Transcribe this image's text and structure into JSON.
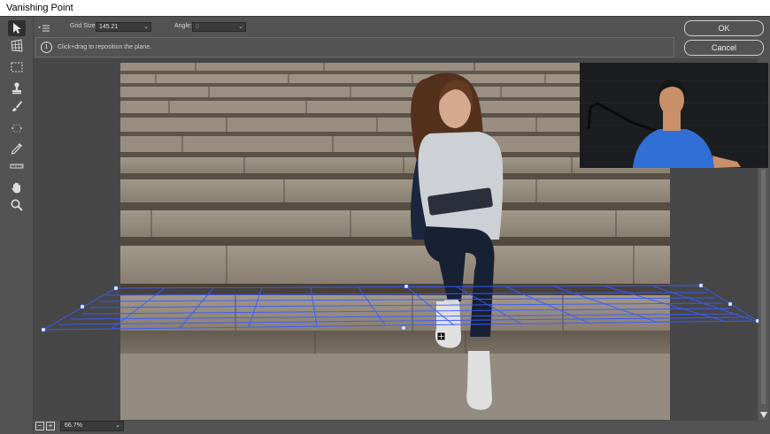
{
  "window": {
    "title": "Vanishing Point"
  },
  "options": {
    "grid_size_label": "Grid Size:",
    "grid_size_value": "145.21",
    "angle_label": "Angle:",
    "angle_value": "0"
  },
  "info": {
    "message": "Click+drag to reposition the plane."
  },
  "buttons": {
    "ok": "OK",
    "cancel": "Cancel"
  },
  "status": {
    "zoom": "66.7%",
    "zoom_out": "−",
    "zoom_in": "+"
  },
  "tools": [
    {
      "name": "edit-plane-tool-icon",
      "active": true
    },
    {
      "name": "create-plane-tool-icon"
    },
    {
      "name": "marquee-tool-icon"
    },
    {
      "name": "stamp-tool-icon"
    },
    {
      "name": "brush-tool-icon"
    },
    {
      "name": "transform-tool-icon"
    },
    {
      "name": "eyedropper-tool-icon"
    },
    {
      "name": "measure-tool-icon"
    },
    {
      "name": "hand-tool-icon"
    },
    {
      "name": "zoom-tool-icon"
    }
  ],
  "colors": {
    "grid_line": "#3a5cff",
    "panel": "#535353",
    "title_bg": "#ffffff"
  }
}
